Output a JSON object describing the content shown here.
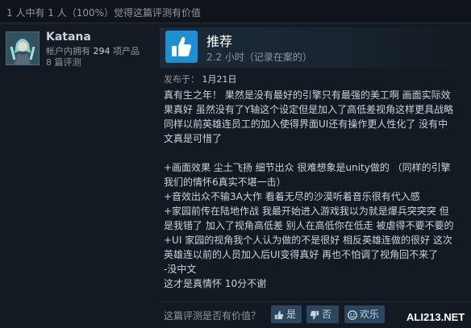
{
  "helpful_summary": "1 人中有 1 人（100%）觉得这篇评测有价值",
  "reviewer": {
    "name": "Katana",
    "owned_prefix": "帐户内拥有",
    "owned_count": "294",
    "owned_suffix": "项产品",
    "reviews": "8 篇评测"
  },
  "review": {
    "verdict": "推荐",
    "hours": "2.2 小时（记录在案的）",
    "posted_label": "发布于：",
    "posted_date": "1月21日",
    "body_lines": [
      "真有生之年！ 果然是没有最好的引擎只有最强的美工啊 画面实际效",
      "果真好 虽然没有了Y轴这个设定但是加入了高低差视角这样更具战略",
      "同样以前英雄连员工的加入使得界面UI还有操作更人性化了 没有中",
      "文真是可惜了",
      "",
      "+画面效果 尘土飞扬 细节出众 很难想象是unity做的 （同样的引擎",
      "我们的情怀6真实不堪一击）",
      "+音效出众不输3A大作 看着无尽的沙漠听着音乐很有代入感",
      "+家园前传在陆地作战 我最开始进入游戏我以为就是爆兵突突突 但",
      "是我错了 加入了视角高低差 别人在高低你在低走 被虐得不要不要的",
      "+UI 家园的视角我个人认为做的不是很好 相反英雄连做的很好 这次",
      "英雄连以前的人员加入后UI变得真好 再也不怕调了视角回不来了",
      "-没中文",
      "这才是真情怀 10分不谢"
    ]
  },
  "footer": {
    "question": "这篇评测是否有价值？",
    "yes": "是",
    "no": "否",
    "funny": "欢乐"
  },
  "watermark": "ALI213.NET",
  "colors": {
    "background": "#141a21",
    "accent": "#1e8fd0",
    "button": "#2a475e"
  },
  "icons": [
    "thumbs-up-icon",
    "thumbs-down-icon",
    "smiley-icon"
  ]
}
